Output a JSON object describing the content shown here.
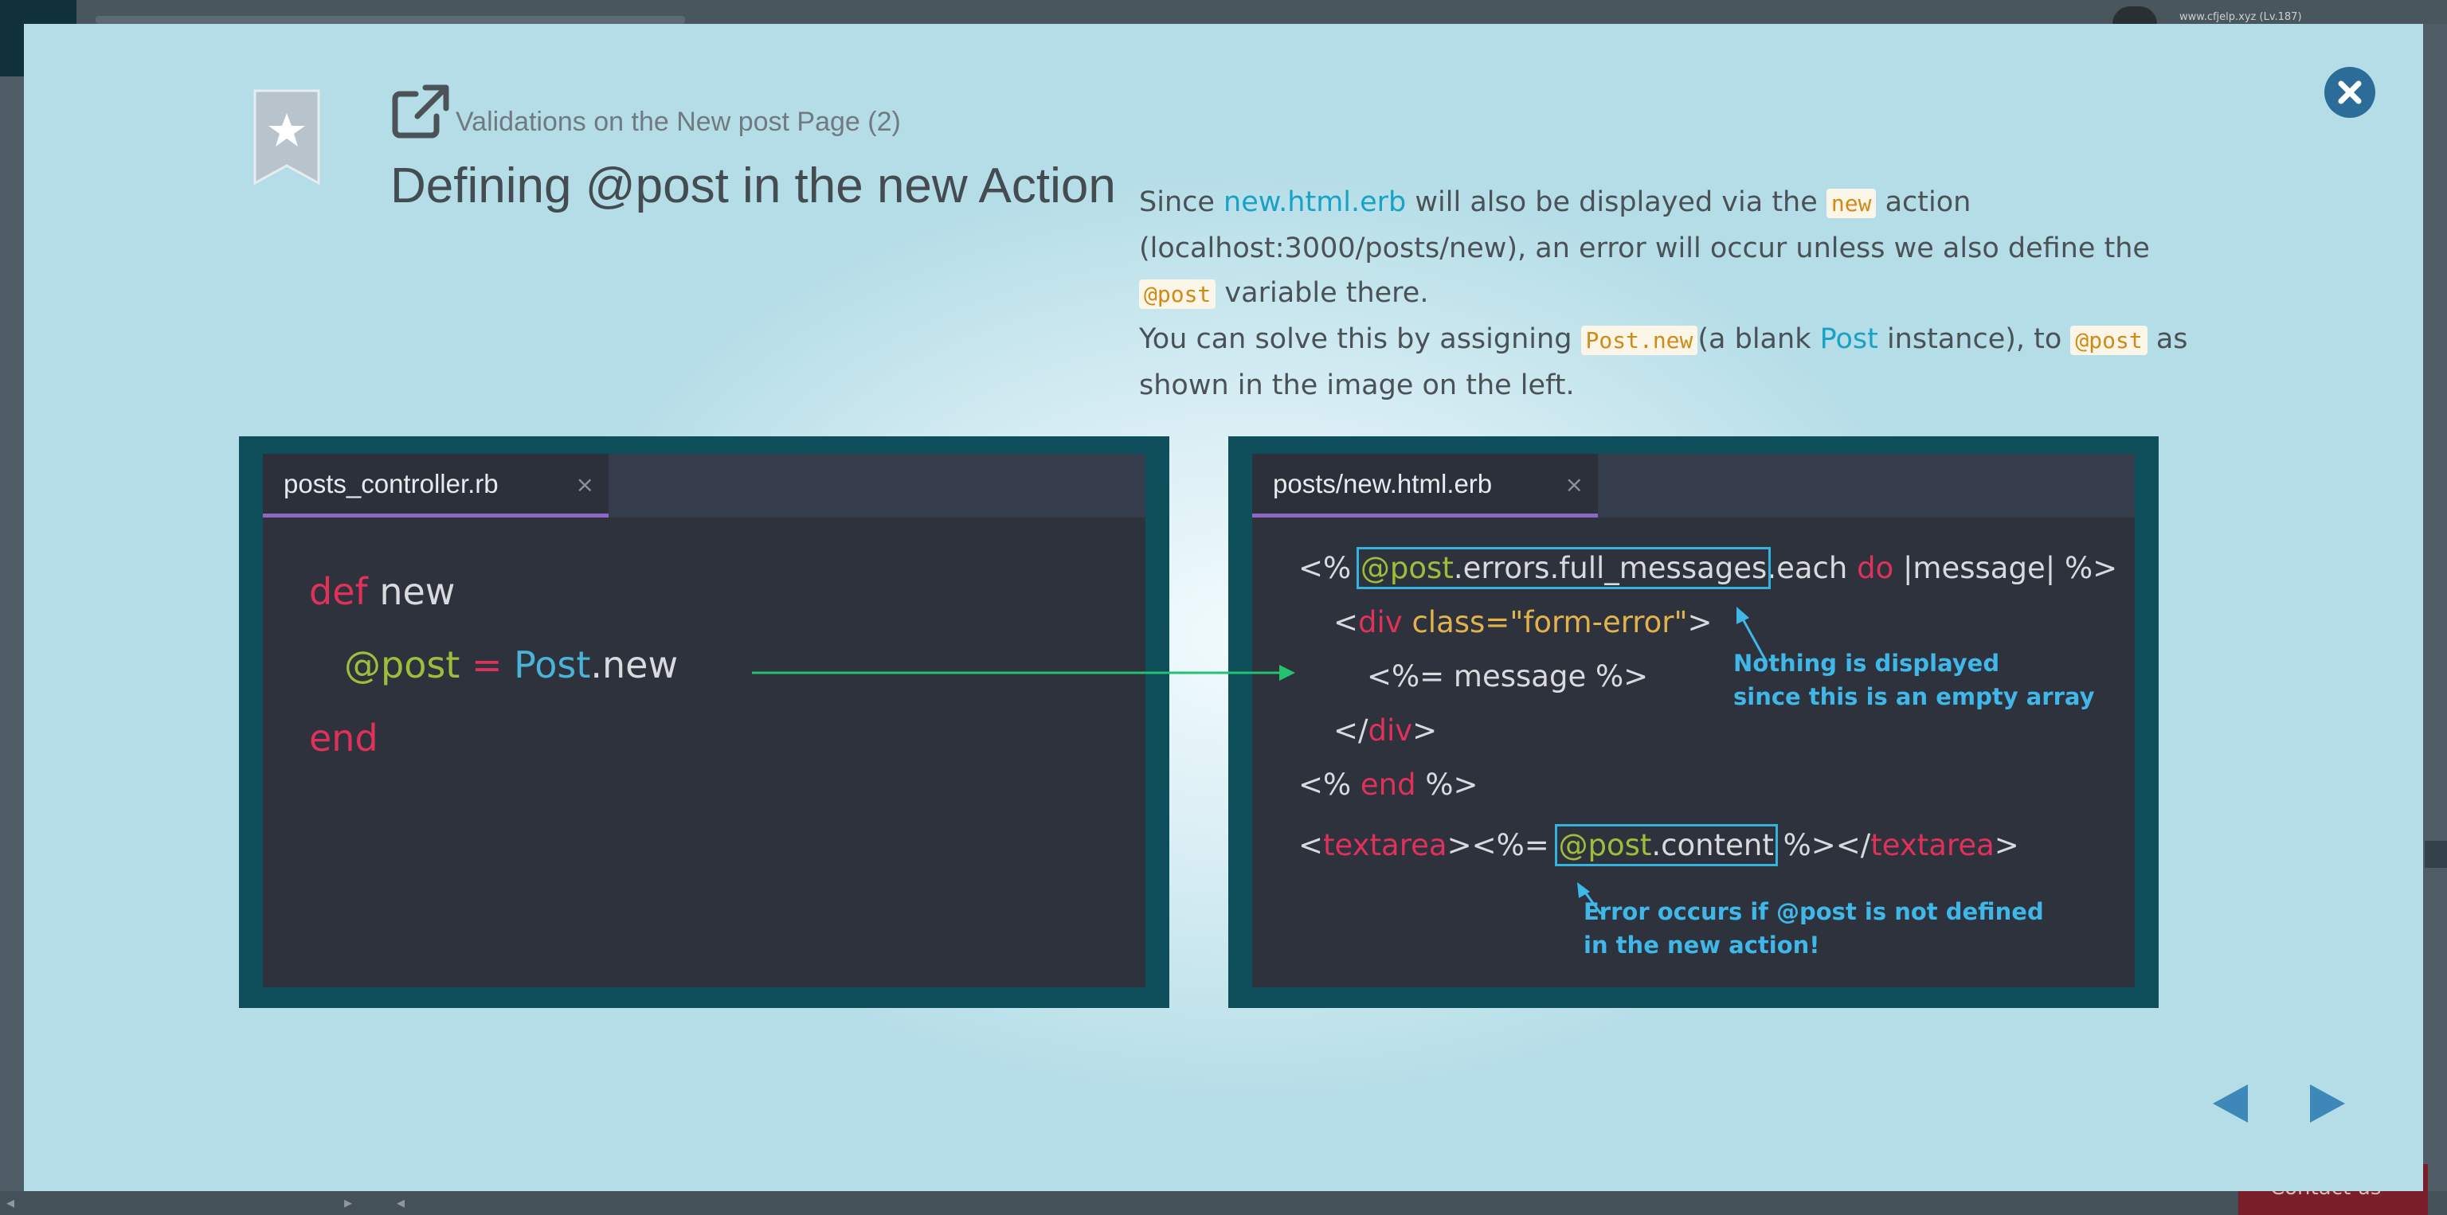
{
  "backdrop": {
    "user_label": "www.cfjelp.xyz (Lv.187)",
    "contact_label": "Contact us"
  },
  "slide": {
    "subtitle": "Validations on the New post Page (2)",
    "title": "Defining @post in the new Action",
    "description": {
      "p1_a": "Since ",
      "p1_link": "new.html.erb",
      "p1_b": " will also be displayed via the ",
      "p1_code": "new",
      "p1_c": " action (localhost:3000/posts/new), an error will occur unless we also define the ",
      "p1_code2": "@post",
      "p1_d": " variable there.",
      "p2_a": "You can solve this by assigning ",
      "p2_code": "Post.new",
      "p2_b": "(a blank ",
      "p2_link": "Post",
      "p2_c": " instance), to ",
      "p2_code2": "@post",
      "p2_d": " as shown in the image on the left."
    }
  },
  "left_editor": {
    "tab_label": "posts_controller.rb",
    "tab_close": "×",
    "code": {
      "l1_kw": "def",
      "l1_name": " new",
      "l2_ivar": "@post",
      "l2_eq": " = ",
      "l2_cls": "Post",
      "l2_method": ".new",
      "l3_kw": "end"
    }
  },
  "right_editor": {
    "tab_label": "posts/new.html.erb",
    "tab_close": "×",
    "code": {
      "l1_open": "<% ",
      "l1_ivar": "@post",
      "l1_chain": ".errors.full_messages",
      "l1_each": ".each ",
      "l1_do": "do",
      "l1_rest": " |message| %>",
      "l2_open": "<",
      "l2_tag": "div",
      "l2_attr": " class=",
      "l2_val": "\"form-error\"",
      "l2_close": ">",
      "l3": "<%= message %>",
      "l4_open": "</",
      "l4_tag": "div",
      "l4_close": ">",
      "l5_open": "<% ",
      "l5_kw": "end",
      "l5_close": " %>",
      "l6_open": "<",
      "l6_tag": "textarea",
      "l6_mid": "><%= ",
      "l6_ivar": "@post",
      "l6_prop": ".content",
      "l6_mid2": " %></",
      "l6_tag2": "textarea",
      "l6_close": ">"
    },
    "note1": "Nothing is displayed\nsince this is an empty array",
    "note2": "Error occurs if @post is not defined\nin the new action!"
  },
  "colors": {
    "panel_frame": "#0f4f5c",
    "editor_bg": "#2d323d",
    "keyword": "#e0315b",
    "instance_var": "#9cbe3a",
    "class_name": "#49b4d7",
    "annotation": "#3fb7e8",
    "tab_underline": "#8c68c8",
    "close_button": "#2b6d98"
  },
  "icons": {
    "bookmark": "bookmark-star-icon",
    "external": "external-link-icon",
    "close": "close-icon",
    "prev": "prev-arrow-icon",
    "next": "next-arrow-icon"
  }
}
